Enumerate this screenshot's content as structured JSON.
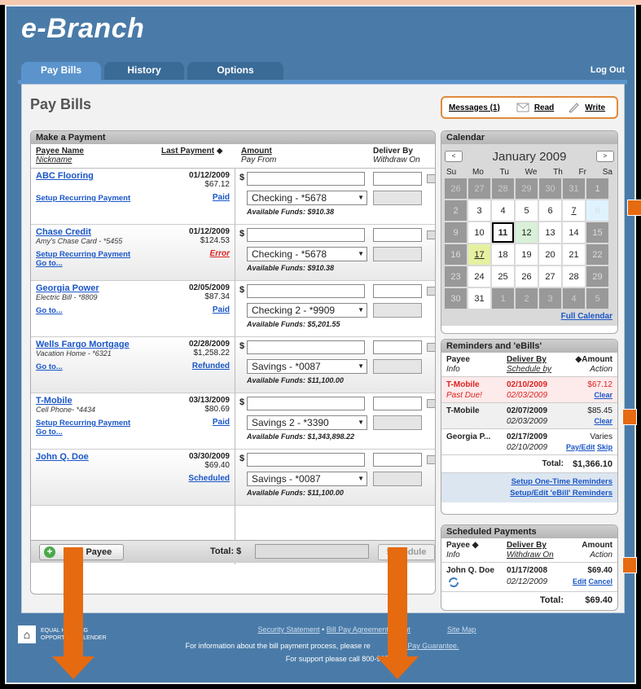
{
  "app": {
    "logo": "e-Branch",
    "logout": "Log Out"
  },
  "tabs": [
    {
      "label": "Pay Bills"
    },
    {
      "label": "History"
    },
    {
      "label": "Options"
    }
  ],
  "page_title": "Pay Bills",
  "messages": {
    "label": "Messages (1)",
    "read": "Read",
    "write": "Write"
  },
  "payment": {
    "box_title": "Make a Payment",
    "headers": {
      "payee": "Payee Name",
      "nickname": "Nickname",
      "last_payment": "Last Payment",
      "amount": "Amount",
      "pay_from": "Pay From",
      "deliver_by": "Deliver By",
      "withdraw_on": "Withdraw On"
    },
    "rows": [
      {
        "payee": "ABC Flooring",
        "nickname": "",
        "link1": "Setup Recurring Payment",
        "link2": "",
        "date": "01/12/2009",
        "amount": "$67.12",
        "status": "Paid",
        "account": "Checking - *5678",
        "funds": "Available Funds: $910.38"
      },
      {
        "payee": "Chase Credit",
        "nickname": "Amy's Chase Card - *5455",
        "link1": "Setup Recurring Payment",
        "link2": "Go to...",
        "date": "01/12/2009",
        "amount": "$124.53",
        "status": "Error",
        "account": "Checking - *5678",
        "funds": "Available Funds: $910.38"
      },
      {
        "payee": "Georgia Power",
        "nickname": "Electric Bill - *8809",
        "link1": "Go to...",
        "link2": "",
        "date": "02/05/2009",
        "amount": "$87.34",
        "status": "Paid",
        "account": "Checking 2 - *9909",
        "funds": "Available Funds: $5,201.55"
      },
      {
        "payee": "Wells Fargo Mortgage",
        "nickname": "Vacation Home - *6321",
        "link1": "Go to...",
        "link2": "",
        "date": "02/28/2009",
        "amount": "$1,258.22",
        "status": "Refunded",
        "account": "Savings - *0087",
        "funds": "Available Funds: $11,100.00"
      },
      {
        "payee": "T-Mobile",
        "nickname": "Cell Phone- *4434",
        "link1": "Setup Recurring Payment",
        "link2": "Go to...",
        "date": "03/13/2009",
        "amount": "$80.69",
        "status": "Paid",
        "account": "Savings 2 - *3390",
        "funds": "Available Funds: $1,343,898.22"
      },
      {
        "payee": "John Q. Doe",
        "nickname": "",
        "link1": "",
        "link2": "",
        "date": "03/30/2009",
        "amount": "$69.40",
        "status": "Scheduled",
        "account": "Savings - *0087",
        "funds": "Available Funds: $11,100.00"
      }
    ],
    "dollar": "$",
    "add_payee": "Add Payee",
    "total_label": "Total: $",
    "schedule": "Schedule"
  },
  "calendar": {
    "title": "Calendar",
    "month": "January 2009",
    "prev": "<",
    "next": ">",
    "dows": [
      "Su",
      "Mo",
      "Tu",
      "We",
      "Th",
      "Fr",
      "Sa"
    ],
    "days": [
      "26",
      "27",
      "28",
      "29",
      "30",
      "31",
      "1",
      "2",
      "3",
      "4",
      "5",
      "6",
      "7",
      "8",
      "9",
      "10",
      "11",
      "12",
      "13",
      "14",
      "15",
      "16",
      "17",
      "18",
      "19",
      "20",
      "21",
      "22",
      "23",
      "24",
      "25",
      "26",
      "27",
      "28",
      "29",
      "30",
      "31",
      "1",
      "2",
      "3",
      "4",
      "5"
    ],
    "full": "Full Calendar"
  },
  "reminders": {
    "title": "Reminders and 'eBills'",
    "h_payee": "Payee",
    "h_info": "Info",
    "h_deliver": "Deliver By",
    "h_schedule": "Schedule by",
    "h_amount": "Amount",
    "h_action": "Action",
    "rows": [
      {
        "payee": "T-Mobile",
        "info": "Past Due!",
        "deliver": "02/10/2009",
        "schedule": "02/03/2009",
        "amount": "$67.12",
        "action": "Clear"
      },
      {
        "payee": "T-Mobile",
        "info": "",
        "deliver": "02/07/2009",
        "schedule": "02/03/2009",
        "amount": "$85.45",
        "action": "Clear"
      },
      {
        "payee": "Georgia P...",
        "info": "",
        "deliver": "02/17/2009",
        "schedule": "02/10/2009",
        "amount": "Varies",
        "action": "Pay/Edit",
        "action2": "Skip"
      }
    ],
    "total_label": "Total:",
    "total": "$1,366.10",
    "link1": "Setup One-Time Reminders",
    "link2": "Setup/Edit 'eBill' Reminders"
  },
  "scheduled": {
    "title": "Scheduled Payments",
    "h_payee": "Payee",
    "h_info": "Info",
    "h_deliver": "Deliver By",
    "h_withdraw": "Withdraw On",
    "h_amount": "Amount",
    "h_action": "Action",
    "row": {
      "payee": "John Q. Doe",
      "deliver": "01/17/2008",
      "withdraw": "02/12/2009",
      "amount": "$69.40",
      "edit": "Edit",
      "cancel": "Cancel"
    },
    "total_label": "Total:",
    "total": "$69.40"
  },
  "footer": {
    "ehl": "EQUAL HOUSING OPPORTUNITY LENDER",
    "link1": "Security Statement",
    "link2": "Bill Pay Agreement",
    "link3": "Cont",
    "link4": "Site Map",
    "line2a": "For information about the bill payment process, please re",
    "line2b": "Bill Pay Guarantee.",
    "line3": "For support please call 800-925-"
  },
  "colors": {
    "accent": "#e66a10",
    "brand": "#4a7ba8",
    "link": "#1a56c8"
  }
}
